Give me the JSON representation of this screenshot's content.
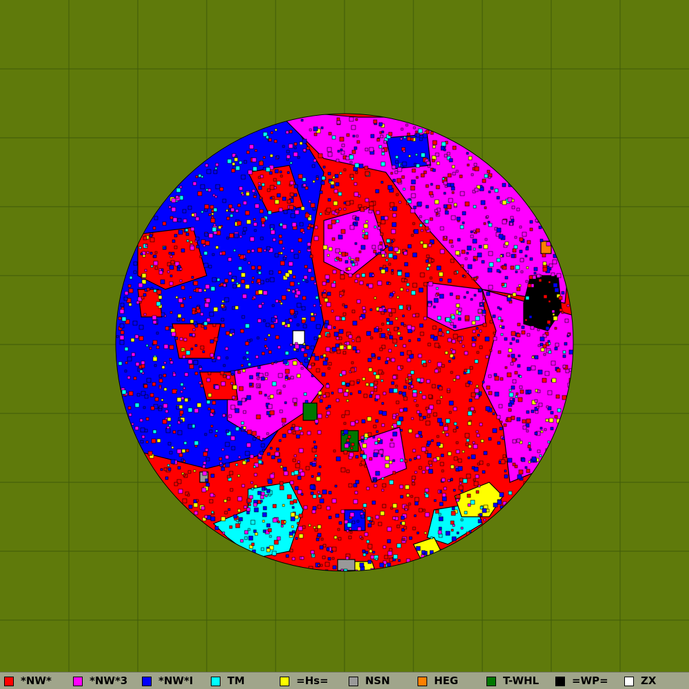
{
  "map": {
    "background_color": "#5f7a0b",
    "grid_color": "#3f5a0a",
    "grid_lines": true,
    "territory_shape": "circle"
  },
  "legend": {
    "items": [
      {
        "label": "*NW*",
        "color": "#ff0000"
      },
      {
        "label": "*NW*3",
        "color": "#ff00ff"
      },
      {
        "label": "*NW*I",
        "color": "#0000ff"
      },
      {
        "label": "TM",
        "color": "#00ffff"
      },
      {
        "label": "=Hs=",
        "color": "#ffff00"
      },
      {
        "label": "NSN",
        "color": "#999999"
      },
      {
        "label": "HEG",
        "color": "#ff8000"
      },
      {
        "label": "T-WHL",
        "color": "#007700"
      },
      {
        "label": "=WP=",
        "color": "#000000"
      },
      {
        "label": "ZX",
        "color": "#ffffff"
      }
    ]
  }
}
